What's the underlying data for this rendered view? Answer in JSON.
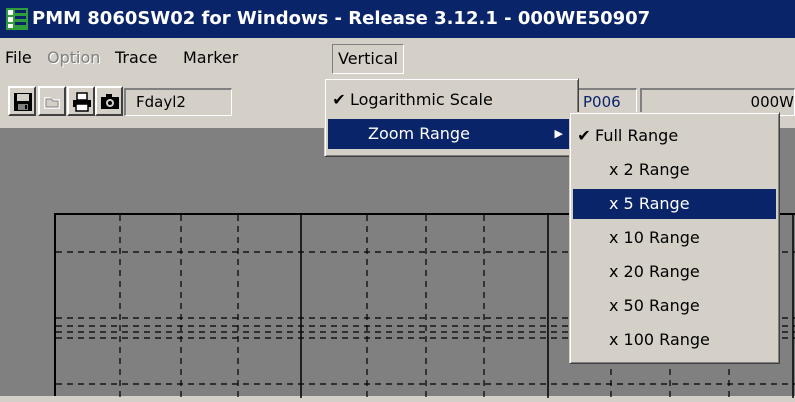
{
  "window": {
    "title": "PMM 8060SW02 for Windows - Release 3.12.1  - 000WE50907"
  },
  "menubar": {
    "items": [
      "File",
      "Option",
      "Trace",
      "Marker",
      "Vertical"
    ]
  },
  "toolbar": {
    "field1": "Fdayl2",
    "field2": "P006",
    "field3": "000W"
  },
  "vertical_menu": {
    "items": [
      {
        "label": "Logarithmic Scale",
        "checked": true
      },
      {
        "label": "Zoom Range",
        "submenu": true
      }
    ]
  },
  "zoom_submenu": {
    "items": [
      {
        "label": "Full Range",
        "checked": true
      },
      {
        "label": "x 2 Range"
      },
      {
        "label": "x 5 Range",
        "highlighted": true
      },
      {
        "label": "x 10 Range"
      },
      {
        "label": "x 20 Range"
      },
      {
        "label": "x 50 Range"
      },
      {
        "label": "x 100 Range"
      }
    ]
  },
  "icons": {
    "checkmark": "✔",
    "submenu_arrow": "▶"
  }
}
